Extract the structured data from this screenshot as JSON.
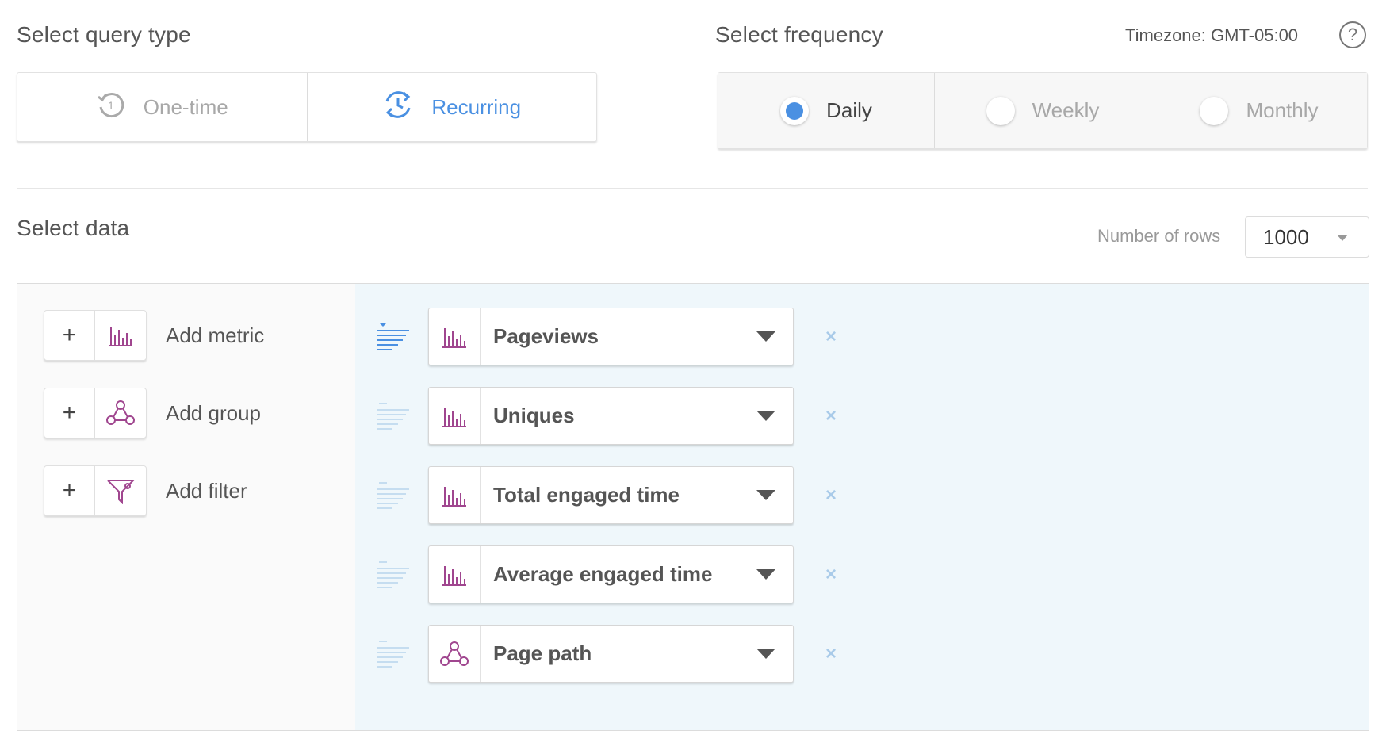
{
  "query_type": {
    "title": "Select query type",
    "options": [
      {
        "label": "One-time",
        "icon": "clock-one-icon",
        "selected": false
      },
      {
        "label": "Recurring",
        "icon": "recurring-clock-icon",
        "selected": true
      }
    ]
  },
  "frequency": {
    "title": "Select frequency",
    "timezone": "Timezone: GMT-05:00",
    "help": "?",
    "options": [
      {
        "label": "Daily",
        "selected": true
      },
      {
        "label": "Weekly",
        "selected": false
      },
      {
        "label": "Monthly",
        "selected": false
      }
    ]
  },
  "data": {
    "title": "Select data",
    "rows_label": "Number of rows",
    "rows_value": "1000",
    "add_actions": [
      {
        "plus": "+",
        "label": "Add metric",
        "icon": "bar-chart-icon"
      },
      {
        "plus": "+",
        "label": "Add group",
        "icon": "group-nodes-icon"
      },
      {
        "plus": "+",
        "label": "Add filter",
        "icon": "filter-funnel-icon"
      }
    ],
    "items": [
      {
        "label": "Pageviews",
        "icon": "bar-chart-icon",
        "remove": "×",
        "sorted": true
      },
      {
        "label": "Uniques",
        "icon": "bar-chart-icon",
        "remove": "×",
        "sorted": false
      },
      {
        "label": "Total engaged time",
        "icon": "bar-chart-icon",
        "remove": "×",
        "sorted": false
      },
      {
        "label": "Average engaged time",
        "icon": "bar-chart-icon",
        "remove": "×",
        "sorted": false
      },
      {
        "label": "Page path",
        "icon": "group-nodes-icon",
        "remove": "×",
        "sorted": false
      }
    ]
  },
  "colors": {
    "accent": "#4a90e2",
    "metric_icon": "#a0468f",
    "panel_right": "#eff7fb"
  }
}
